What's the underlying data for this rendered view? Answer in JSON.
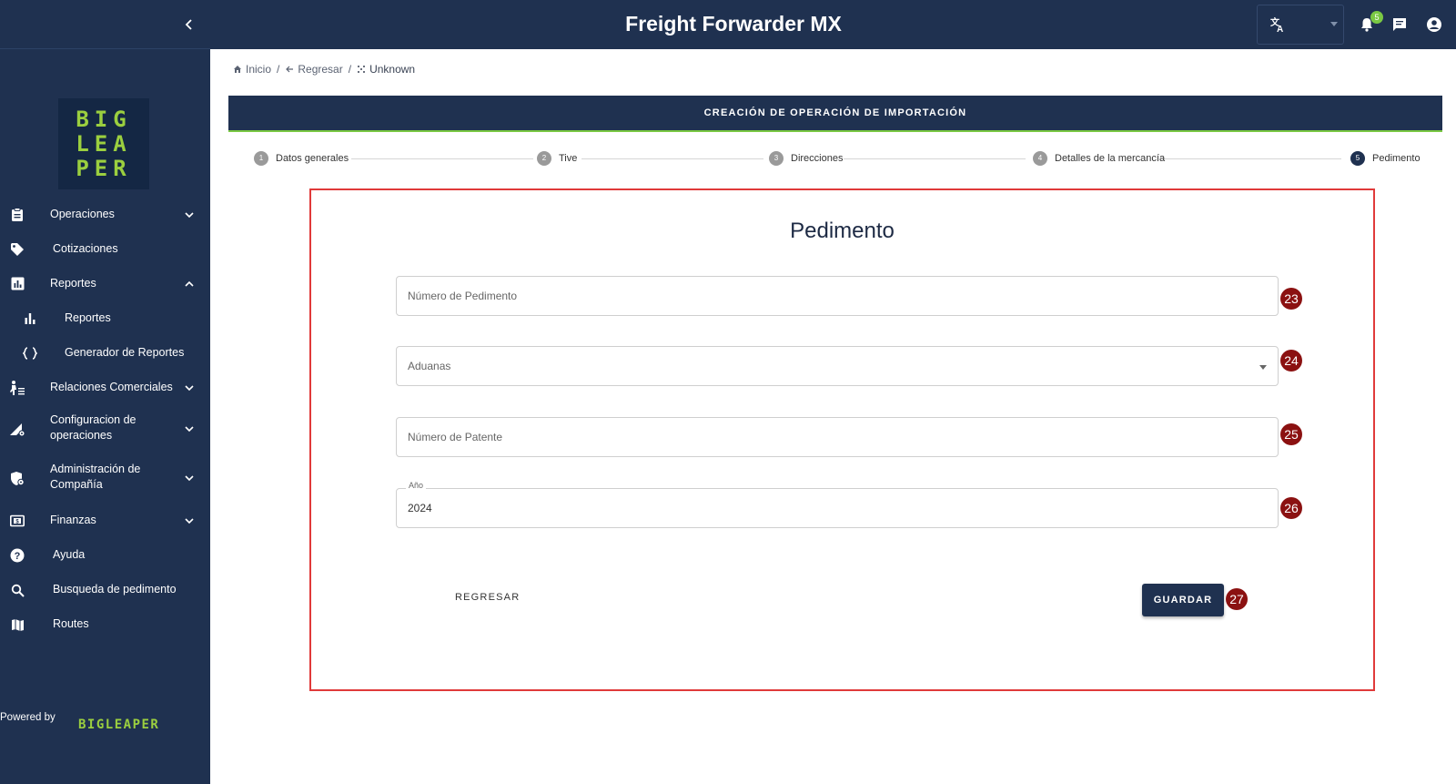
{
  "app": {
    "title": "Freight Forwarder MX"
  },
  "header": {
    "notifications_count": "5"
  },
  "logo": {
    "line1": "BIG",
    "line2": "LEA",
    "line3": "PER"
  },
  "sidebar": {
    "items": [
      {
        "label": "Operaciones",
        "icon": "clipboard-icon",
        "expandable": true,
        "expanded": false
      },
      {
        "label": "Cotizaciones",
        "icon": "tag-icon",
        "expandable": false
      },
      {
        "label": "Reportes",
        "icon": "chart-icon",
        "expandable": true,
        "expanded": true
      },
      {
        "label": "Reportes",
        "icon": "bar-chart-icon",
        "sub": true
      },
      {
        "label": "Generador de Reportes",
        "icon": "braces-icon",
        "sub": true
      },
      {
        "label": "Relaciones Comerciales",
        "icon": "person-list-icon",
        "expandable": true,
        "expanded": false
      },
      {
        "label": "Configuracion de operaciones",
        "label1": "Configuracion de",
        "label2": "operaciones",
        "icon": "settings-tool-icon",
        "expandable": true,
        "expanded": false
      },
      {
        "label": "Administración de Compañía",
        "label1": "Administración de",
        "label2": "Compañía",
        "icon": "admin-shield-icon",
        "expandable": true,
        "expanded": false
      },
      {
        "label": "Finanzas",
        "icon": "money-icon",
        "expandable": true,
        "expanded": false
      },
      {
        "label": "Ayuda",
        "icon": "help-icon",
        "expandable": false
      },
      {
        "label": "Busqueda de pedimento",
        "icon": "search-icon",
        "expandable": false
      },
      {
        "label": "Routes",
        "icon": "map-icon",
        "expandable": false
      }
    ],
    "powered_by": "Powered by",
    "powered_logo": "BIGLEAPER"
  },
  "breadcrumb": [
    {
      "label": "Inicio",
      "icon": "home-icon"
    },
    {
      "label": "Regresar",
      "icon": "arrow-left-icon"
    },
    {
      "label": "Unknown",
      "icon": "dots-icon"
    }
  ],
  "banner": {
    "title": "CREACIÓN DE OPERACIÓN DE IMPORTACIÓN"
  },
  "stepper": [
    {
      "num": "1",
      "label": "Datos generales",
      "active": false
    },
    {
      "num": "2",
      "label": "Tive",
      "active": false
    },
    {
      "num": "3",
      "label": "Direcciones",
      "active": false
    },
    {
      "num": "4",
      "label": "Detalles de la mercancía",
      "active": false
    },
    {
      "num": "5",
      "label": "Pedimento",
      "active": true
    }
  ],
  "form": {
    "title": "Pedimento",
    "fields": {
      "numero_pedimento": {
        "placeholder": "Número de Pedimento",
        "value": ""
      },
      "aduanas": {
        "placeholder": "Aduanas",
        "value": ""
      },
      "numero_patente": {
        "placeholder": "Número de Patente",
        "value": ""
      },
      "anio": {
        "label": "Año",
        "value": "2024"
      }
    },
    "back_label": "REGRESAR",
    "save_label": "GUARDAR"
  },
  "markers": [
    "23",
    "24",
    "25",
    "26",
    "27"
  ],
  "colors": {
    "primary": "#1f3150",
    "accent": "#7ac943",
    "highlight_border": "#e03a3a",
    "marker": "#8b1111"
  }
}
